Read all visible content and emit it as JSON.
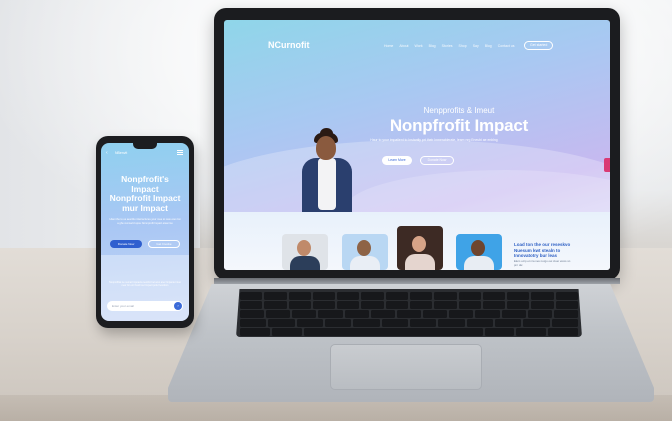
{
  "laptop": {
    "logo": "NCurnofit",
    "nav_items": [
      "Home",
      "About",
      "Work",
      "Blog",
      "Stories",
      "Shop",
      "Say",
      "Blog",
      "Contact us"
    ],
    "nav_cta": "Get started",
    "hero_subtitle": "Nenpprofits & Imeut",
    "hero_title": "Nonpfrofit Impact",
    "hero_description": "Haur to your impatient to Instantly prt their Inmerablerate, leam nrg Eneubi ae enblng",
    "primary_button": "Learn More",
    "secondary_button": "Donate Now",
    "right_heading": "Load ton the our reseskvo Nuesum kwt stealn to Innovatotry bur leas",
    "right_text": "Elem ocrp et nra nes norgu oei ctuer eicos sn pnr dw"
  },
  "phone": {
    "brand": "NBenvit",
    "hero_title_lines": [
      "Nonpfrofit's",
      "Impact",
      "Nonpfrofit Impact",
      "mur Impact"
    ],
    "hero_text": "Hlavt the to us aeurtbu inlerrectures your mue to reav eoo rrat a ghe remowrd upou Nonnprofit lmpact eisenrou",
    "primary_button": "Donate Now",
    "secondary_button": "Get Involve",
    "panel_text": "Nonprofiliat ne nemat Impoacta neotrtic bel amo aner Impantet ntuo neur for enr frwrd tner Impact pofe frenotiion",
    "search_placeholder": "Enter your email",
    "search_button_icon": "›"
  }
}
